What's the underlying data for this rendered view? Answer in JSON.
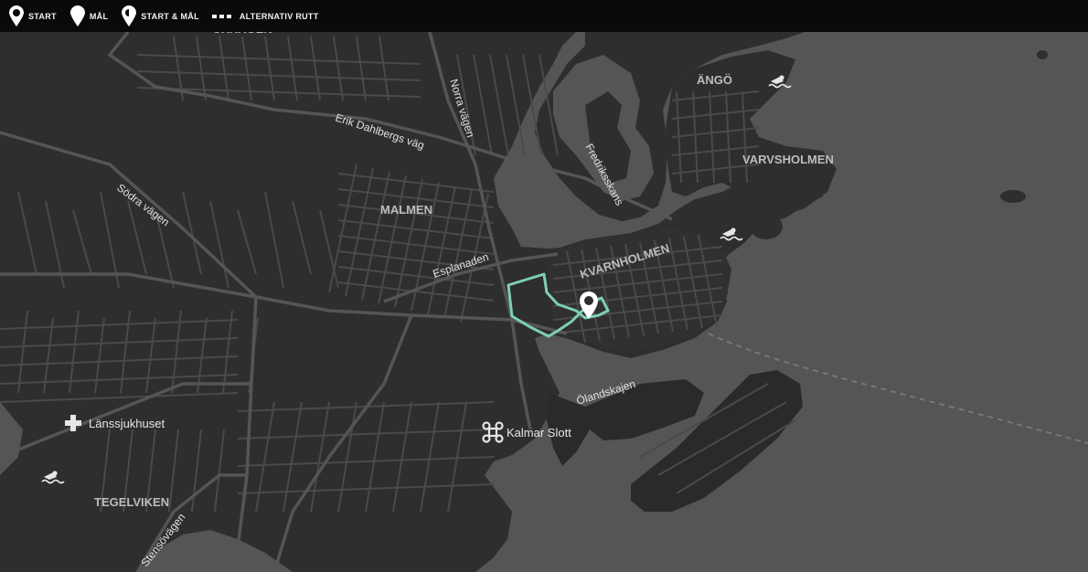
{
  "legend": {
    "start": "START",
    "goal": "MÅL",
    "start_goal": "START & MÅL",
    "alt_route": "ALTERNATIV RUTT"
  },
  "districts": {
    "oxhagen": "OXHAGEN",
    "malmen": "MALMEN",
    "kvarnholmen": "KVARNHOLMEN",
    "ango": "ÄNGÖ",
    "varvsholmen": "VARVSHOLMEN",
    "tegelviken": "TEGELVIKEN"
  },
  "streets": {
    "erik_dahlbergs": "Erik Dahlbergs väg",
    "norra_vagen": "Norra vägen",
    "sodra_vagen": "Södra vägen",
    "esplanaden": "Esplanaden",
    "fredriksskans": "Fredriksskans",
    "olandskajen": "Ölandskajen",
    "stensovagen": "Stensövägen"
  },
  "pois": {
    "hospital": "Länssjukhuset",
    "castle": "Kalmar Slott"
  },
  "icons": {
    "start": "map-pin-icon",
    "goal": "teardrop-pin-icon",
    "start_goal": "half-filled-pin-icon",
    "hospital": "cross-icon",
    "castle": "command-key-icon",
    "swim": "swimmer-icon"
  },
  "colors": {
    "water": "#555555",
    "land": "#2e2e2e",
    "roads": "#4a4a4a",
    "route": "#7fcfb3",
    "legend_bg": "#0a0a0a",
    "label": "#bdbdbd"
  }
}
